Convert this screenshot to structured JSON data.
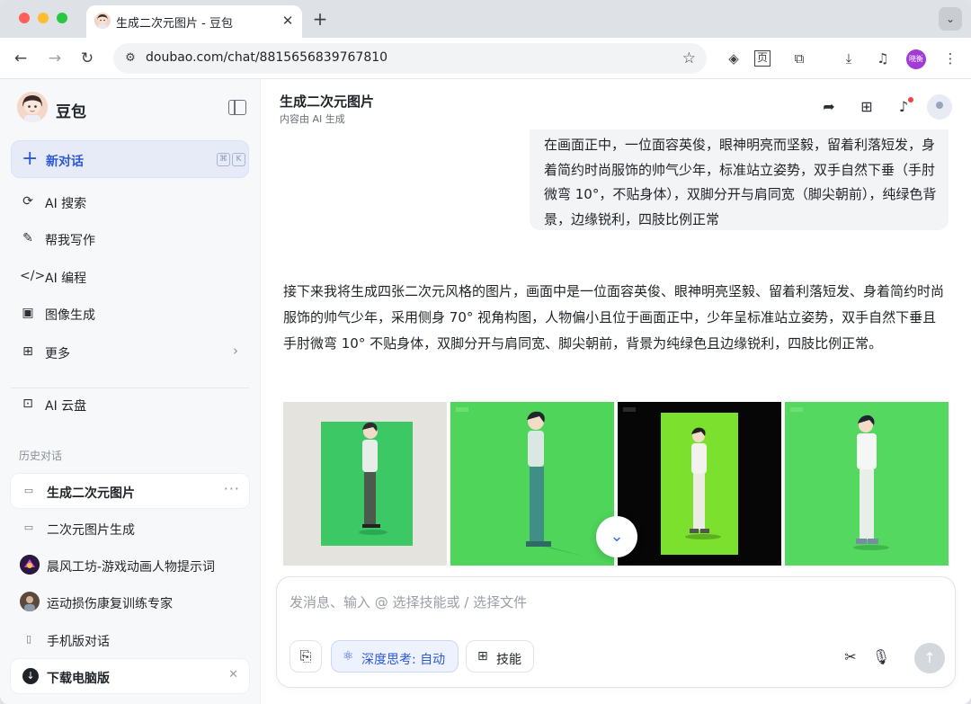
{
  "browser": {
    "tab_title": "生成二次元图片 - 豆包",
    "url": "doubao.com/chat/8815656839767810",
    "profile_label": "晓衡",
    "icons": [
      "back-icon",
      "forward-icon",
      "reload-icon",
      "site-info-icon",
      "star-icon",
      "extension-icon",
      "download-icon",
      "media-icon"
    ]
  },
  "sidebar": {
    "brand": "豆包",
    "new_chat": {
      "label": "新对话",
      "shortcut_1": "⌘",
      "shortcut_2": "K"
    },
    "nav": [
      {
        "label": "AI 搜索",
        "icon": "search-icon"
      },
      {
        "label": "帮我写作",
        "icon": "pen-icon"
      },
      {
        "label": "AI 编程",
        "icon": "code-icon"
      },
      {
        "label": "图像生成",
        "icon": "image-icon"
      },
      {
        "label": "更多",
        "icon": "grid-icon"
      },
      {
        "label": "AI 云盘",
        "icon": "cloud-drive-icon"
      }
    ],
    "history_title": "历史对话",
    "history": [
      {
        "label": "生成二次元图片",
        "active": true
      },
      {
        "label": "二次元图片生成"
      },
      {
        "label": "晨风工坊-游戏动画人物提示词"
      },
      {
        "label": "运动损伤康复训练专家"
      },
      {
        "label": "手机版对话"
      }
    ],
    "download": "下载电脑版"
  },
  "header": {
    "title": "生成二次元图片",
    "subtitle": "内容由 AI 生成"
  },
  "chat": {
    "user_message": "在画面正中，一位面容英俊，眼神明亮而坚毅，留着利落短发，身着简约时尚服饰的帅气少年，标准站立姿势，双手自然下垂（手肘微弯 10°，不贴身体），双脚分开与肩同宽（脚尖朝前），纯绿色背景，边缘锐利，四肢比例正常",
    "bot_message": "接下来我将生成四张二次元风格的图片，画面中是一位面容英俊、眼神明亮坚毅、留着利落短发、身着简约时尚服饰的帅气少年，采用侧身 70° 视角构图，人物偏小且位于画面正中，少年呈标准站立姿势，双手自然下垂且手肘微弯 10° 不贴身体，双脚分开与肩同宽、脚尖朝前，背景为纯绿色且边缘锐利，四肢比例正常。"
  },
  "composer": {
    "placeholder": "发消息、输入 @ 选择技能或 / 选择文件",
    "deep_think": "深度思考: 自动",
    "skills": "技能"
  },
  "colors": {
    "accent": "#2f58d8",
    "green_bg": "#4fd65a",
    "lime_bg": "#7be02e"
  }
}
